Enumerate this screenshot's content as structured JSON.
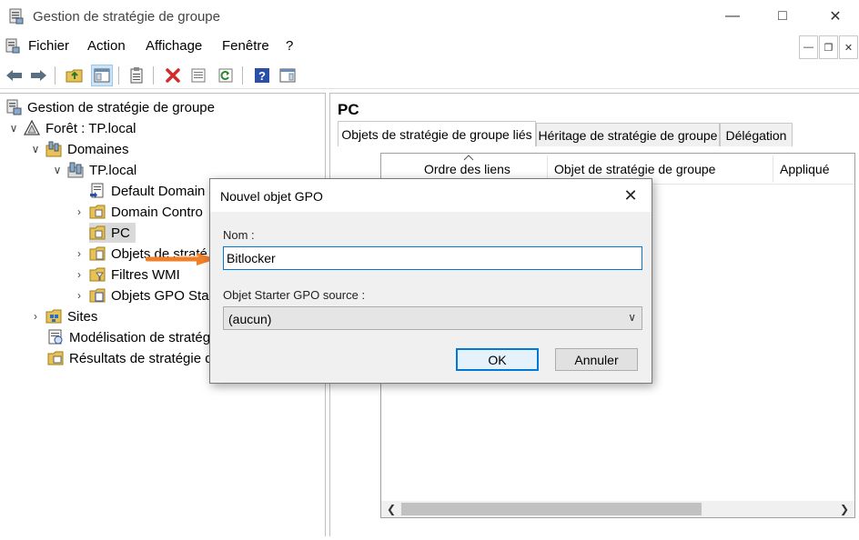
{
  "window": {
    "title": "Gestion de stratégie de groupe",
    "minimize_icon": "minimize-icon",
    "maximize_icon": "maximize-icon",
    "close_icon": "close-icon"
  },
  "menubar": {
    "items": [
      "Fichier",
      "Action",
      "Affichage",
      "Fenêtre",
      "?"
    ]
  },
  "toolbar": {
    "buttons": [
      "back-arrow-icon",
      "forward-arrow-icon",
      "folder-up-icon",
      "show-tree-icon",
      "clipboard-icon",
      "delete-icon",
      "properties-icon",
      "refresh-icon",
      "help-icon",
      "action-pane-icon"
    ]
  },
  "tree": {
    "root": "Gestion de stratégie de groupe",
    "forest": "Forêt : TP.local",
    "domains": "Domaines",
    "domain": "TP.local",
    "default_policy": "Default Domain",
    "domain_controllers": "Domain Contro",
    "pc": "PC",
    "gpo_objects": "Objets de straté",
    "wmi_filters": "Filtres WMI",
    "starter_gpo": "Objets GPO Sta",
    "sites": "Sites",
    "modeling": "Modélisation de stratég",
    "results": "Résultats de stratégie d"
  },
  "rightpane": {
    "title": "PC",
    "tabs": [
      "Objets de stratégie de groupe liés",
      "Héritage de stratégie de groupe",
      "Délégation"
    ],
    "columns": [
      "Ordre des liens",
      "Objet de stratégie de groupe",
      "Appliqué"
    ]
  },
  "dialog": {
    "title": "Nouvel objet GPO",
    "name_label": "Nom :",
    "name_value": "Bitlocker",
    "starter_label": "Objet Starter GPO source :",
    "starter_value": "(aucun)",
    "ok": "OK",
    "cancel": "Annuler"
  },
  "colors": {
    "accent": "#0078d7",
    "annotation_arrow": "#f07f2a"
  }
}
